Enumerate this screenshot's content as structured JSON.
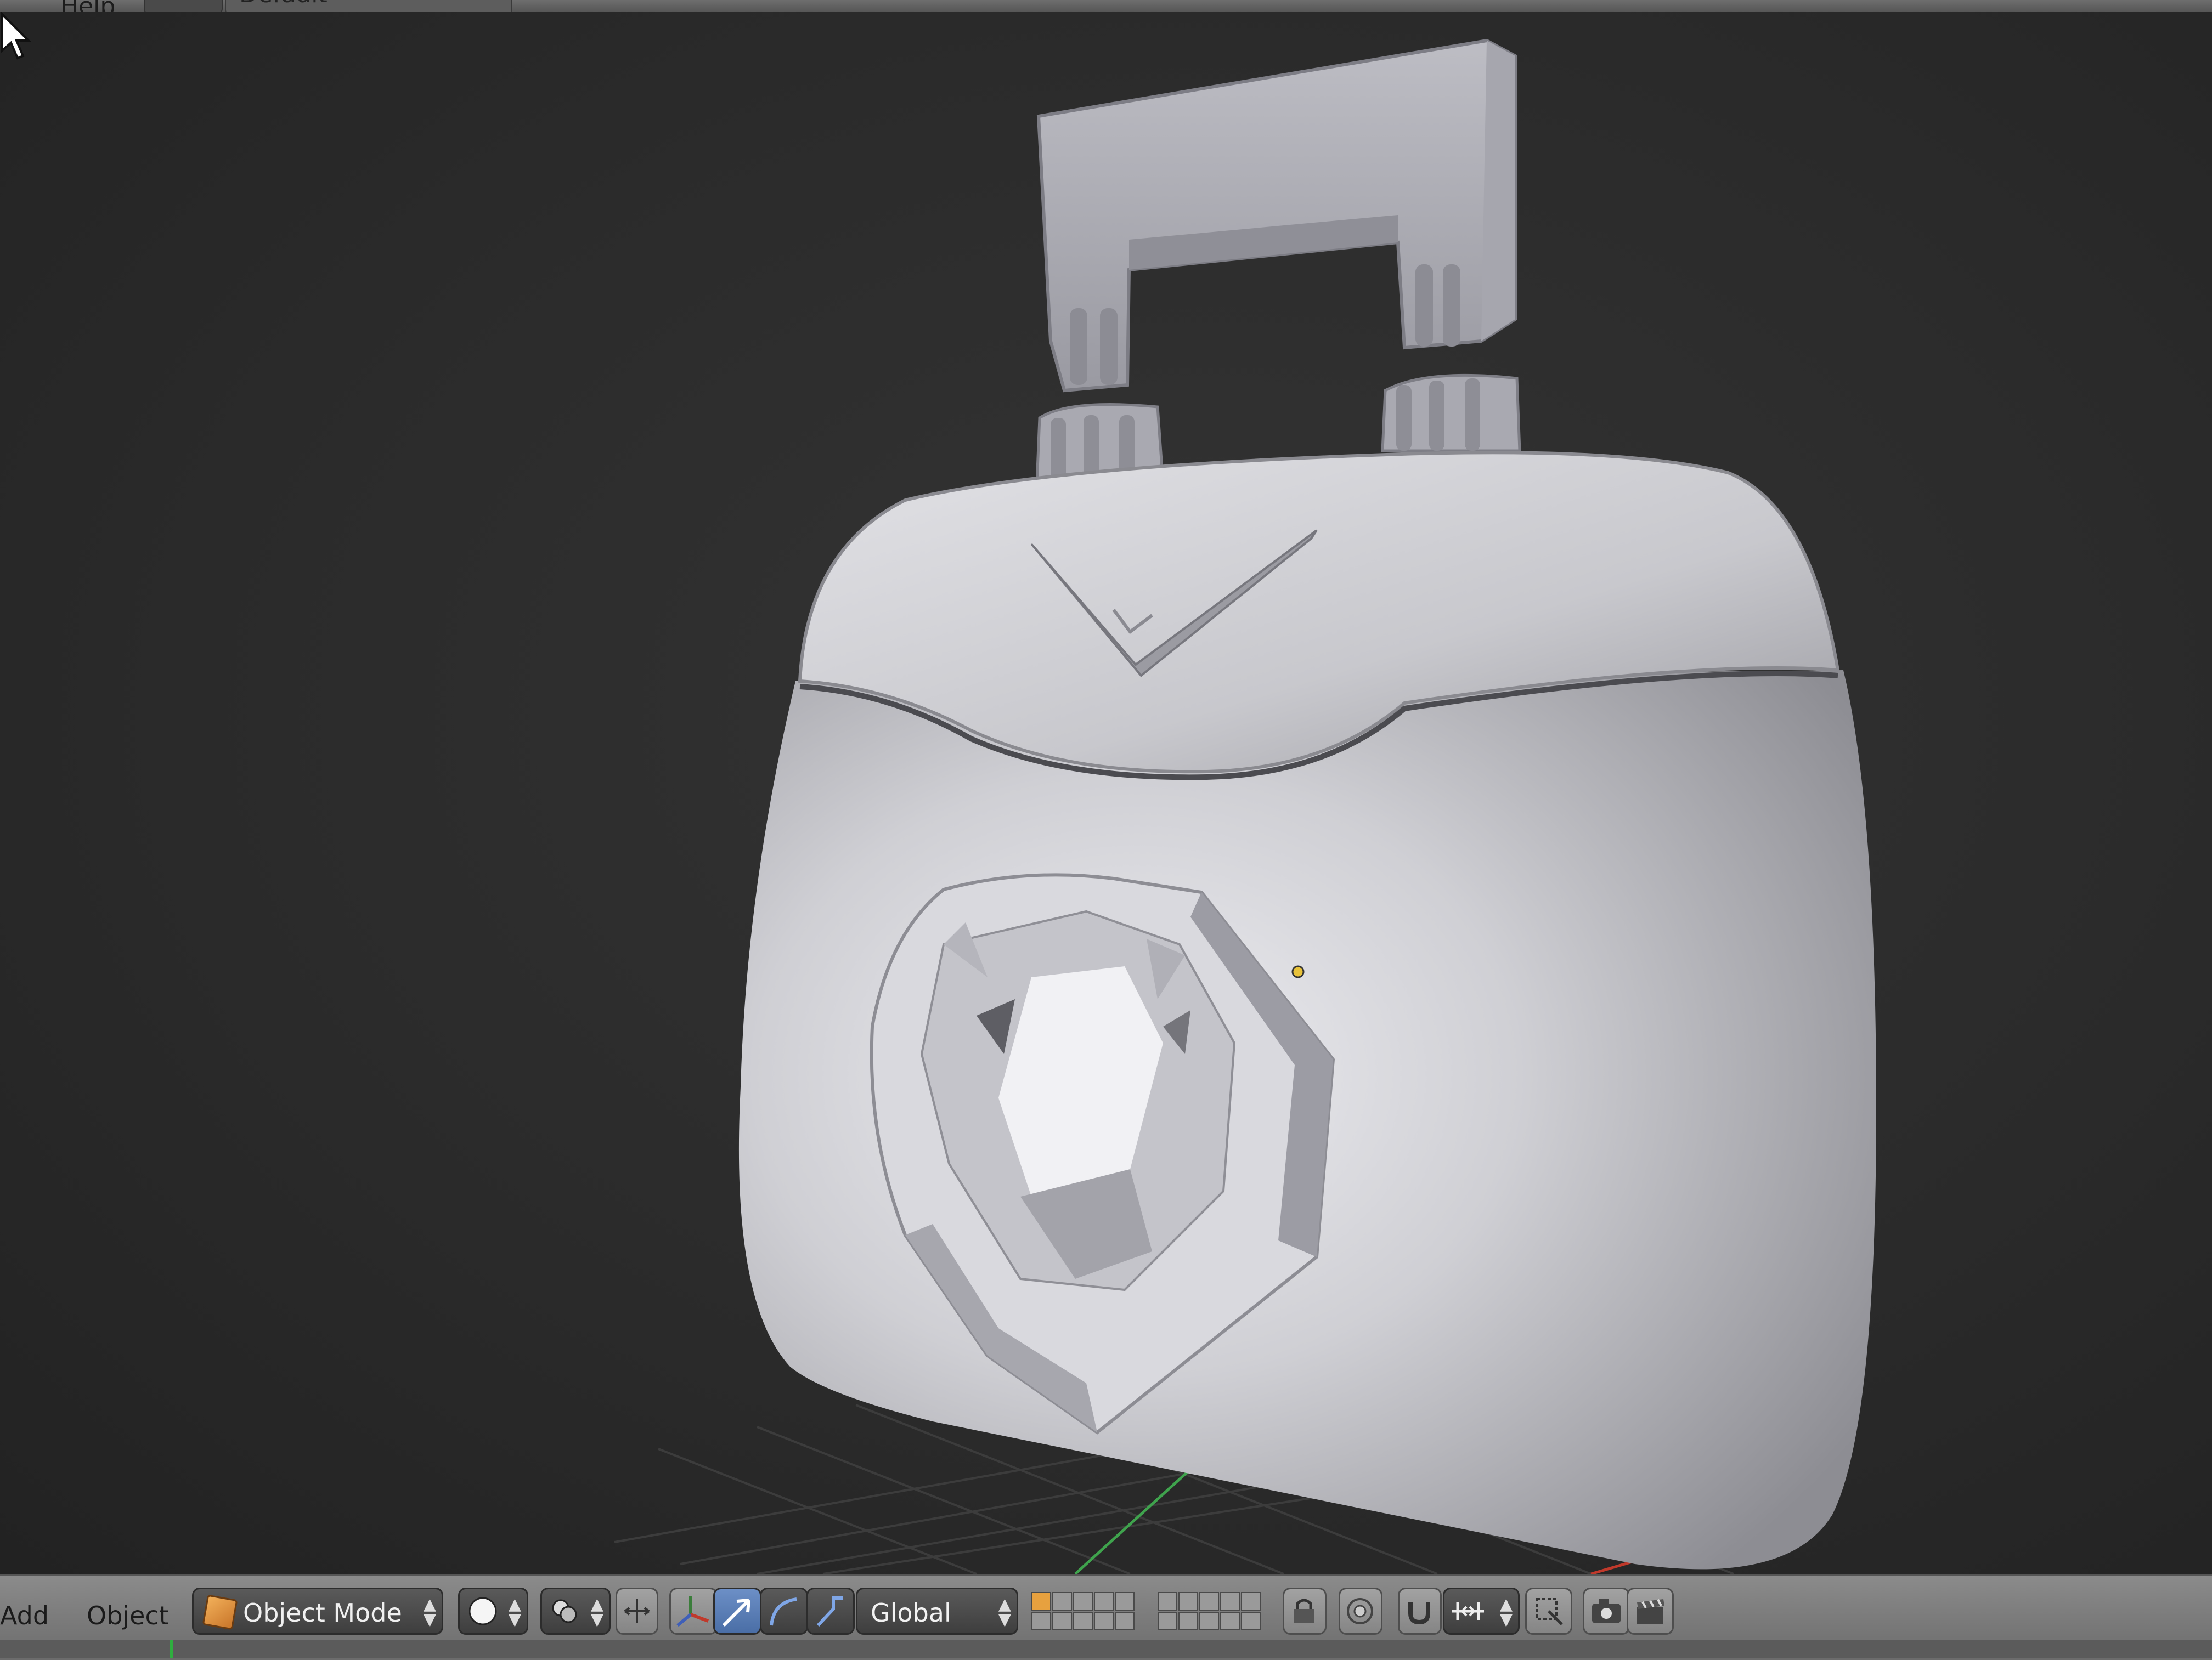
{
  "top_menu": {
    "help_label": "Help",
    "layout_name": "Default"
  },
  "header": {
    "add_label": "Add",
    "object_label": "Object",
    "mode_label": "Object Mode",
    "orientation_label": "Global"
  },
  "icons": {
    "viewport_shading": "sphere-icon",
    "pivot": "pivot-icon",
    "manipulator": "manipulator-axes-icon",
    "translate": "translate-arrow-icon",
    "rotate": "rotate-arc-icon",
    "scale": "scale-icon",
    "layers": "layer-grid-icon",
    "lock": "lock-icon",
    "proportional": "proportional-edit-icon",
    "snap": "magnet-icon",
    "snap_element": "snap-element-icon",
    "render": "camera-icon",
    "render_anim": "clapper-icon"
  },
  "colors": {
    "mode_icon": "#e39a3e",
    "active_tool": "#5a7fb8",
    "viewport_bg": "#2e2e2e",
    "model": "#c9c9cf",
    "grid_x_axis": "#c0392b",
    "grid_y_axis": "#3fa34d",
    "selection_origin": "#e8c23a"
  }
}
